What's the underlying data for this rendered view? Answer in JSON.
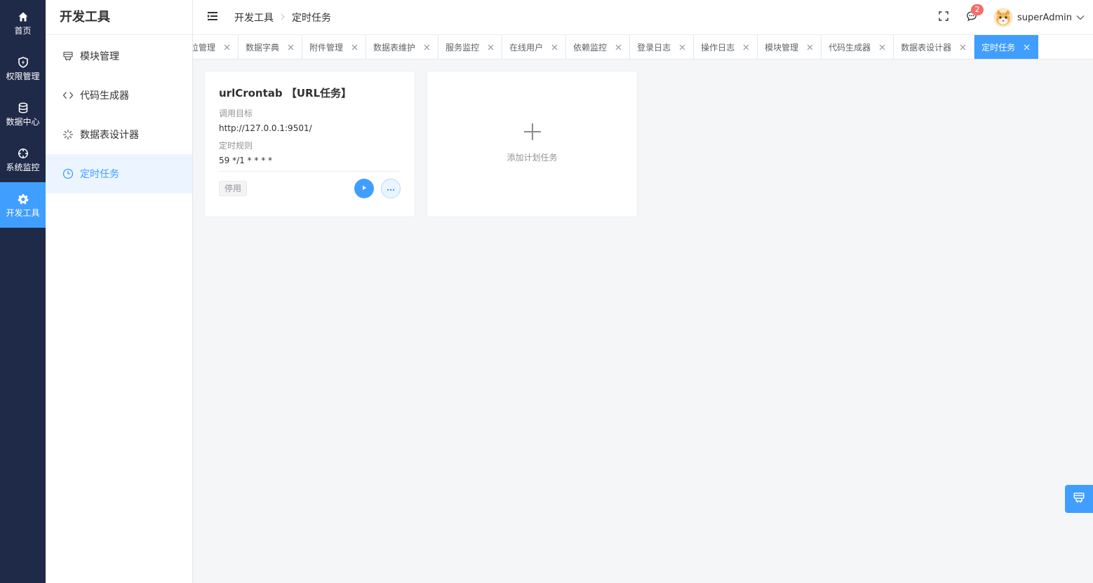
{
  "rail": {
    "items": [
      {
        "label": "首页",
        "icon": "home-icon"
      },
      {
        "label": "权限管理",
        "icon": "shield-icon"
      },
      {
        "label": "数据中心",
        "icon": "database-icon"
      },
      {
        "label": "系统监控",
        "icon": "crosshair-icon"
      },
      {
        "label": "开发工具",
        "icon": "gear-icon",
        "active": true
      }
    ]
  },
  "submenu": {
    "title": "开发工具",
    "items": [
      {
        "label": "模块管理",
        "icon": "module-icon"
      },
      {
        "label": "代码生成器",
        "icon": "code-icon"
      },
      {
        "label": "数据表设计器",
        "icon": "loading-icon"
      },
      {
        "label": "定时任务",
        "icon": "clock-icon",
        "active": true
      }
    ]
  },
  "header": {
    "breadcrumb": [
      "开发工具",
      "定时任务"
    ],
    "notification_count": "2",
    "username": "superAdmin"
  },
  "tabs": [
    {
      "label": "岗位管理"
    },
    {
      "label": "数据字典"
    },
    {
      "label": "附件管理"
    },
    {
      "label": "数据表维护"
    },
    {
      "label": "服务监控"
    },
    {
      "label": "在线用户"
    },
    {
      "label": "依赖监控"
    },
    {
      "label": "登录日志"
    },
    {
      "label": "操作日志"
    },
    {
      "label": "模块管理"
    },
    {
      "label": "代码生成器"
    },
    {
      "label": "数据表设计器"
    },
    {
      "label": "定时任务",
      "active": true
    }
  ],
  "task_card": {
    "title": "urlCrontab 【URL任务】",
    "target_label": "调用目标",
    "target_value": "http://127.0.0.1:9501/",
    "rule_label": "定时规则",
    "rule_value": "59 */1 * * * *",
    "status": "停用"
  },
  "add_card": {
    "label": "添加计划任务"
  },
  "colors": {
    "primary": "#409eff",
    "rail_bg": "#1f2a48",
    "badge": "#f56c6c"
  }
}
